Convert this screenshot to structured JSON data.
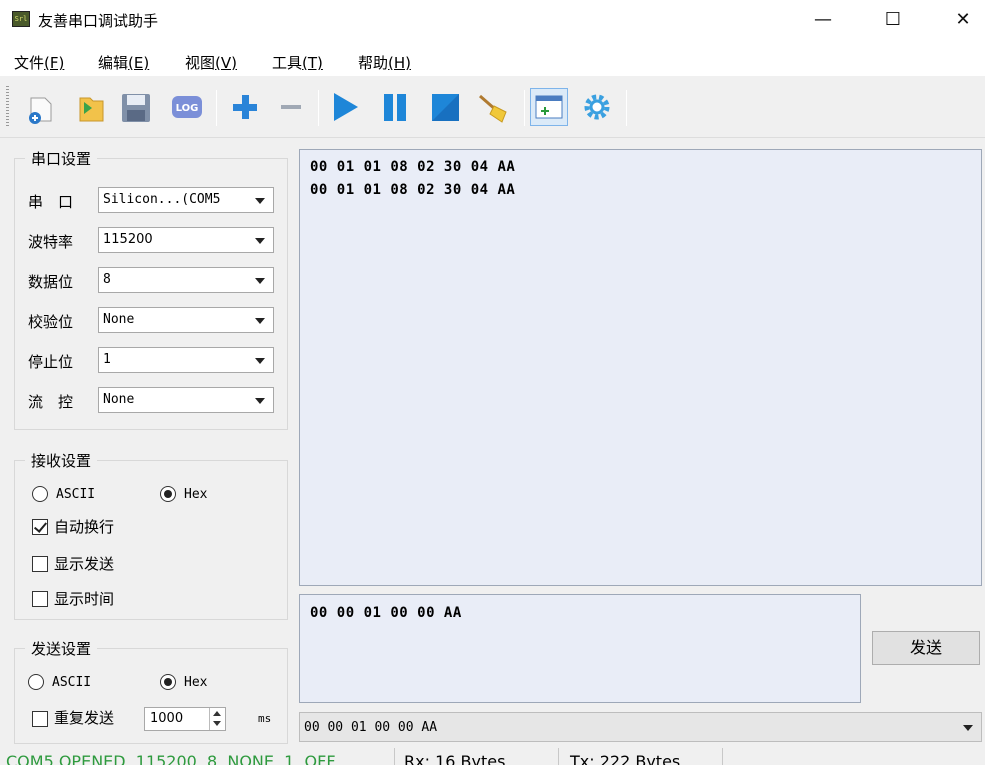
{
  "window": {
    "title": "友善串口调试助手",
    "app_icon_text": "Serial",
    "minimize": "—",
    "maximize": "☐",
    "close": "✕"
  },
  "menu": [
    {
      "label": "文件",
      "key": "(F)"
    },
    {
      "label": "编辑",
      "key": "(E)"
    },
    {
      "label": "视图",
      "key": "(V)"
    },
    {
      "label": "工具",
      "key": "(T)"
    },
    {
      "label": "帮助",
      "key": "(H)"
    }
  ],
  "toolbar": {
    "icons": [
      "new-file-icon",
      "open-folder-icon",
      "save-icon",
      "log-icon",
      "add-icon",
      "remove-icon",
      "play-icon",
      "pause-icon",
      "stop-icon",
      "clear-broom-icon",
      "add-window-icon",
      "settings-gear-icon"
    ],
    "log_label": "LOG"
  },
  "serial_settings": {
    "title": "串口设置",
    "port_label": "串　口",
    "port_value": "Silicon...(COM5",
    "baud_label": "波特率",
    "baud_value": "115200",
    "databits_label": "数据位",
    "databits_value": "8",
    "parity_label": "校验位",
    "parity_value": "None",
    "stopbits_label": "停止位",
    "stopbits_value": "1",
    "flow_label": "流　控",
    "flow_value": "None"
  },
  "receive_settings": {
    "title": "接收设置",
    "ascii_label": "ASCII",
    "hex_label": "Hex",
    "mode": "hex",
    "auto_wrap_label": "自动换行",
    "auto_wrap": true,
    "show_send_label": "显示发送",
    "show_send": false,
    "show_time_label": "显示时间",
    "show_time": false
  },
  "send_settings": {
    "title": "发送设置",
    "ascii_label": "ASCII",
    "hex_label": "Hex",
    "mode": "hex",
    "repeat_label": "重复发送",
    "repeat": false,
    "interval_value": "1000",
    "interval_unit": "ms"
  },
  "receive_lines": [
    "00 01 01 08 02 30 04 AA",
    "00 01 01 08 02 30 04 AA"
  ],
  "send_text": "00 00 01 00 00 AA",
  "send_button": "发送",
  "history_value": "00 00 01 00 00 AA",
  "status": {
    "connection": "COM5 OPENED, 115200, 8, NONE, 1, OFF",
    "rx": "Rx: 16 Bytes",
    "tx": "Tx: 222 Bytes",
    "connection_color": "#2e9a3e"
  }
}
